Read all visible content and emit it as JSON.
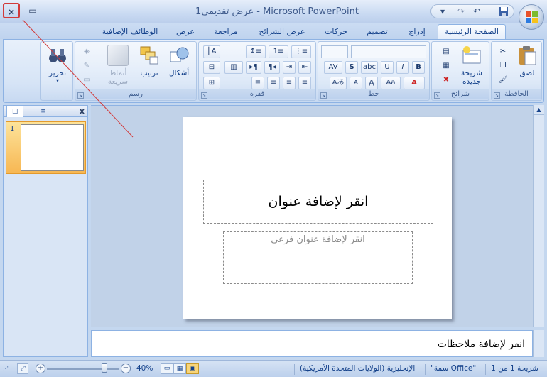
{
  "window": {
    "title": "عرض تقديمي1 - Microsoft PowerPoint",
    "close_glyph": "×",
    "max_glyph": "▭",
    "min_glyph": "–"
  },
  "qat": {
    "save_icon": "save-icon",
    "undo_icon": "undo-icon",
    "redo_icon": "redo-icon",
    "more_icon": "chevron-down-icon"
  },
  "tabs": [
    {
      "label": "الصفحة الرئيسية",
      "active": true
    },
    {
      "label": "إدراج"
    },
    {
      "label": "تصميم"
    },
    {
      "label": "حركات"
    },
    {
      "label": "عرض الشرائح"
    },
    {
      "label": "مراجعة"
    },
    {
      "label": "عرض"
    },
    {
      "label": "الوظائف الإضافية"
    }
  ],
  "groups": {
    "clipboard": {
      "label": "الحافظة",
      "paste": "لصق"
    },
    "slides": {
      "label": "شرائح",
      "new_slide_line1": "شريحة",
      "new_slide_line2": "جديدة"
    },
    "font": {
      "label": "خط",
      "bold": "B",
      "italic": "I",
      "underline": "U",
      "strike": "abc",
      "shadow": "S",
      "spacing": "AV",
      "case": "Aa",
      "grow": "A",
      "shrink": "A",
      "color": "A"
    },
    "paragraph": {
      "label": "فقرة"
    },
    "drawing": {
      "label": "رسم",
      "shapes": "أشكال",
      "arrange": "ترتيب",
      "quick_styles_line1": "أنماط",
      "quick_styles_line2": "سريعة"
    },
    "editing": {
      "label": "",
      "edit": "تحرير"
    }
  },
  "left_pane": {
    "tab_slides": "☐",
    "tab_outline": "≡",
    "close": "x",
    "slide_number": "1"
  },
  "slide": {
    "title_placeholder": "انقر لإضافة عنوان",
    "subtitle_placeholder": "انقر لإضافة عنوان فرعي"
  },
  "notes": {
    "placeholder": "انقر لإضافة ملاحظات"
  },
  "status": {
    "slide_count": "شريحة 1 من 1",
    "theme": "\"سمة Office\"",
    "language": "الإنجليزية (الولايات المتحدة الأمريكية)",
    "zoom": "40%"
  },
  "colors": {
    "accent": "#15428b",
    "ribbon": "#d6e4f6",
    "annotation": "#d23a3a"
  }
}
